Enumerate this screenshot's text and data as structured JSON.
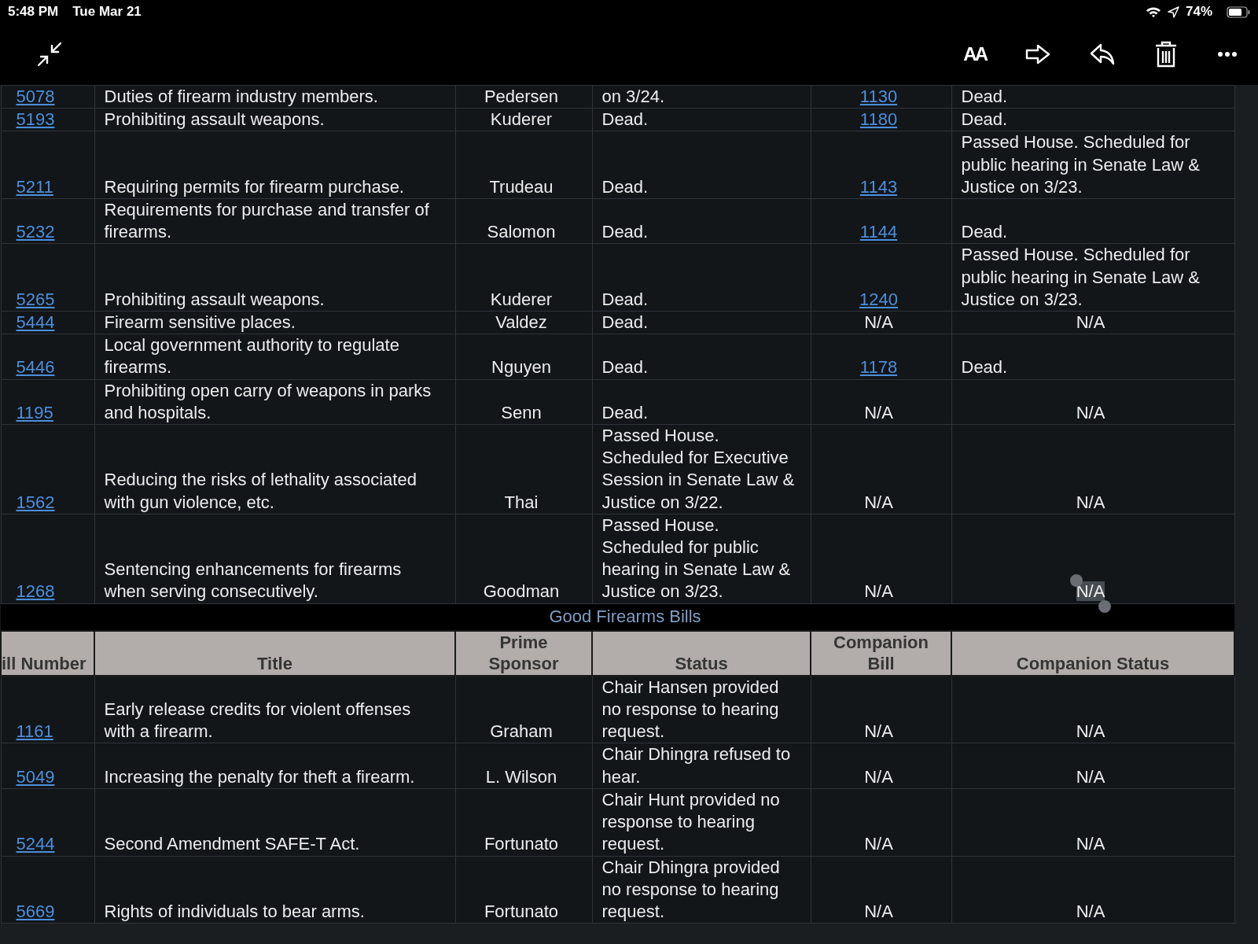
{
  "status_bar": {
    "time": "5:48 PM",
    "date": "Tue Mar 21",
    "battery": "74%"
  },
  "toolbar": {
    "font_button": "AA"
  },
  "rows_top": [
    {
      "bill": "5078",
      "title": "Duties of firearm industry members.",
      "sponsor": "Pedersen",
      "status": "on 3/24.",
      "companion_bill": "1130",
      "companion_link": true,
      "companion_status": "Dead.",
      "companion_selected": false
    },
    {
      "bill": "5193",
      "title": "Prohibiting assault weapons.",
      "sponsor": "Kuderer",
      "status": "Dead.",
      "companion_bill": "1180",
      "companion_link": true,
      "companion_status": "Dead.",
      "companion_selected": false
    },
    {
      "bill": "5211",
      "title": "Requiring permits for firearm purchase.",
      "sponsor": "Trudeau",
      "status": "Dead.",
      "companion_bill": "1143",
      "companion_link": true,
      "companion_status": "Passed House. Scheduled for public hearing in Senate Law & Justice on 3/23.",
      "companion_selected": false
    },
    {
      "bill": "5232",
      "title": "Requirements for purchase and transfer of firearms.",
      "sponsor": "Salomon",
      "status": "Dead.",
      "companion_bill": "1144",
      "companion_link": true,
      "companion_status": "Dead.",
      "companion_selected": false
    },
    {
      "bill": "5265",
      "title": "Prohibiting assault weapons.",
      "sponsor": "Kuderer",
      "status": "Dead.",
      "companion_bill": "1240",
      "companion_link": true,
      "companion_status": "Passed House. Scheduled for public hearing in Senate Law & Justice on 3/23.",
      "companion_selected": false
    },
    {
      "bill": "5444",
      "title": "Firearm sensitive places.",
      "sponsor": "Valdez",
      "status": "Dead.",
      "companion_bill": "N/A",
      "companion_link": false,
      "companion_status": "N/A",
      "companion_selected": false
    },
    {
      "bill": "5446",
      "title": "Local government authority to regulate firearms.",
      "sponsor": "Nguyen",
      "status": "Dead.",
      "companion_bill": "1178",
      "companion_link": true,
      "companion_status": "Dead.",
      "companion_selected": false
    },
    {
      "bill": "1195",
      "title": "Prohibiting open carry of weapons in parks and hospitals.",
      "sponsor": "Senn",
      "status": "Dead.",
      "companion_bill": "N/A",
      "companion_link": false,
      "companion_status": "N/A",
      "companion_selected": false
    },
    {
      "bill": "1562",
      "title": "Reducing the risks of lethality associated with gun violence, etc.",
      "sponsor": "Thai",
      "status": "Passed House. Scheduled for Executive Session in Senate Law & Justice on 3/22.",
      "companion_bill": "N/A",
      "companion_link": false,
      "companion_status": "N/A",
      "companion_selected": false
    },
    {
      "bill": "1268",
      "title": "Sentencing enhancements for firearms when serving consecutively.",
      "sponsor": "Goodman",
      "status": "Passed House. Scheduled for public hearing in Senate Law & Justice on 3/23.",
      "companion_bill": "N/A",
      "companion_link": false,
      "companion_status": "N/A",
      "companion_selected": true
    }
  ],
  "section_title": "Good Firearms Bills",
  "columns": [
    "ill Number",
    "Title",
    "Prime Sponsor",
    "Status",
    "Companion Bill",
    "Companion Status"
  ],
  "rows_bottom": [
    {
      "bill": "1161",
      "title": "Early release credits for violent offenses with a firearm.",
      "sponsor": "Graham",
      "status": "Chair Hansen provided no response to hearing request.",
      "companion_bill": "N/A",
      "companion_link": false,
      "companion_status": "N/A",
      "companion_selected": false
    },
    {
      "bill": "5049",
      "title": "Increasing the penalty for theft a firearm.",
      "sponsor": "L. Wilson",
      "status": "Chair Dhingra refused to hear.",
      "companion_bill": "N/A",
      "companion_link": false,
      "companion_status": "N/A",
      "companion_selected": false
    },
    {
      "bill": "5244",
      "title": "Second Amendment SAFE-T Act.",
      "sponsor": "Fortunato",
      "status": "Chair Hunt provided no response to hearing request.",
      "companion_bill": "N/A",
      "companion_link": false,
      "companion_status": "N/A",
      "companion_selected": false
    },
    {
      "bill": "5669",
      "title": "Rights of individuals to bear arms.",
      "sponsor": "Fortunato",
      "status": "Chair Dhingra provided no response to hearing request.",
      "companion_bill": "N/A",
      "companion_link": false,
      "companion_status": "N/A",
      "companion_selected": false
    }
  ]
}
